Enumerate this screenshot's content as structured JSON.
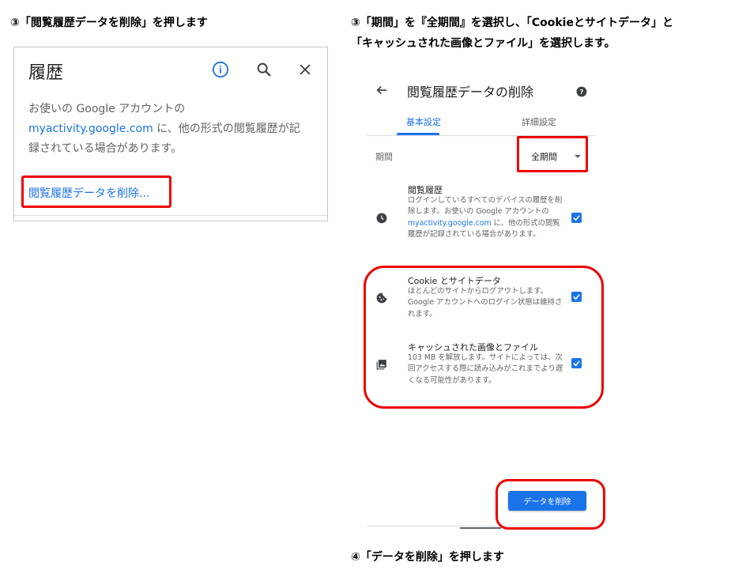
{
  "steps": {
    "left_caption": "③「閲覧履歴データを削除」を押します",
    "right_caption_line1": "③「期間」を『全期間』を選択し、「Cookieとサイトデータ」と",
    "right_caption_line2": "「キャッシュされた画像とファイル」を選択します。",
    "bottom_caption": "④「データを削除」を押します"
  },
  "history_panel": {
    "title": "履歴",
    "body_line1": "お使いの Google アカウントの",
    "body_link": "myactivity.google.com",
    "body_after_link": " に、他の形式の閲覧履歴が記",
    "body_line3": "録されている場合があります。",
    "delete_link": "閲覧履歴データを削除..."
  },
  "dialog": {
    "title": "閲覧履歴データの削除",
    "tabs": [
      "基本設定",
      "詳細設定"
    ],
    "period_label": "期間",
    "period_value": "全期間",
    "items": [
      {
        "title": "閲覧履歴",
        "desc_before_link": "ログインしているすべてのデバイスの履歴を削除します。お使いの Google アカウントの ",
        "desc_link": "myactivity.google.com",
        "desc_after_link": " に、他の形式の閲覧履歴が記録されている場合があります。",
        "checked": true
      },
      {
        "title": "Cookie とサイトデータ",
        "desc": "ほとんどのサイトからログアウトします。Google アカウントへのログイン状態は維持されます。",
        "checked": true
      },
      {
        "title": "キャッシュされた画像とファイル",
        "desc": "103 MB を解放します。サイトによっては、次回アクセスする際に読み込みがこれまでより遅くなる可能性があります。",
        "checked": true
      }
    ],
    "delete_button": "データを削除"
  },
  "colors": {
    "accent": "#1a73e8",
    "highlight": "#ee0000",
    "text_secondary": "#5f6368"
  },
  "icons": [
    "info-icon",
    "search-icon",
    "close-icon",
    "back-arrow-icon",
    "help-icon",
    "clock-icon",
    "cookie-icon",
    "image-icon",
    "checkbox-checked-icon"
  ]
}
